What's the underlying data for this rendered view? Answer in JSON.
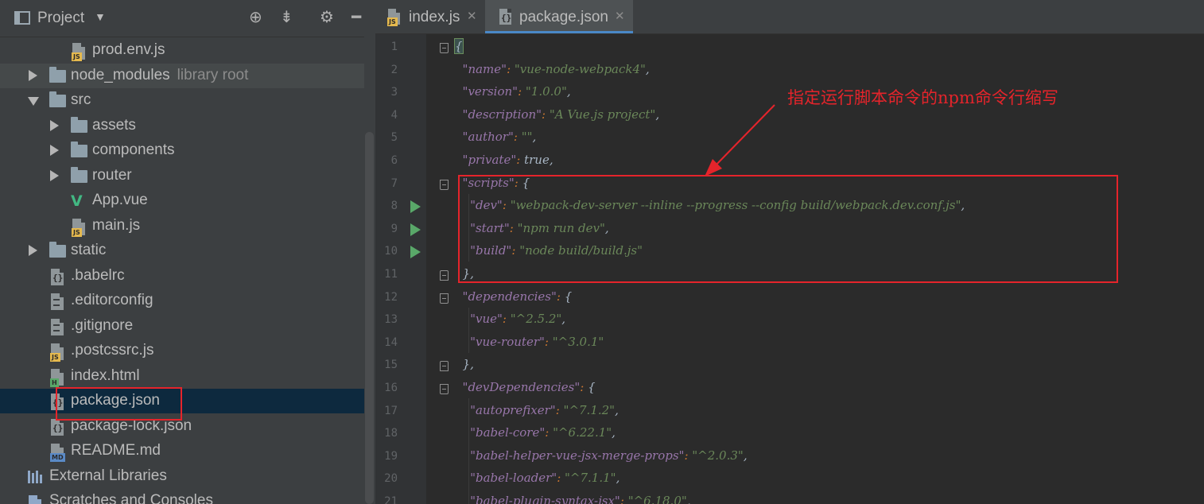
{
  "project": {
    "title": "Project",
    "header_icons": [
      "crosshair-icon",
      "collapse-icon",
      "gear-icon",
      "minimize-icon"
    ],
    "tree": [
      {
        "label": "prod.env.js",
        "icon": "js-file-icon",
        "depth": 3
      },
      {
        "label": "node_modules",
        "extra": "library root",
        "icon": "folder-icon",
        "depth": 1,
        "arrow": "right"
      },
      {
        "label": "src",
        "icon": "folder-icon",
        "depth": 1,
        "arrow": "down"
      },
      {
        "label": "assets",
        "icon": "folder-icon",
        "depth": 2,
        "arrow": "right"
      },
      {
        "label": "components",
        "icon": "folder-icon",
        "depth": 2,
        "arrow": "right"
      },
      {
        "label": "router",
        "icon": "folder-icon",
        "depth": 2,
        "arrow": "right"
      },
      {
        "label": "App.vue",
        "icon": "vue-file-icon",
        "depth": 3
      },
      {
        "label": "main.js",
        "icon": "js-file-icon",
        "depth": 3
      },
      {
        "label": "static",
        "icon": "folder-icon",
        "depth": 1,
        "arrow": "right"
      },
      {
        "label": ".babelrc",
        "icon": "json-file-icon",
        "depth": 2
      },
      {
        "label": ".editorconfig",
        "icon": "text-file-icon",
        "depth": 2
      },
      {
        "label": ".gitignore",
        "icon": "text-file-icon",
        "depth": 2
      },
      {
        "label": ".postcssrc.js",
        "icon": "js-file-icon",
        "depth": 2
      },
      {
        "label": "index.html",
        "icon": "html-file-icon",
        "depth": 2
      },
      {
        "label": "package.json",
        "icon": "json-file-icon",
        "depth": 2,
        "selected": true
      },
      {
        "label": "package-lock.json",
        "icon": "json-file-icon",
        "depth": 2
      },
      {
        "label": "README.md",
        "icon": "md-file-icon",
        "depth": 2
      },
      {
        "label": "External Libraries",
        "icon": "libraries-icon",
        "depth": 1
      },
      {
        "label": "Scratches and Consoles",
        "icon": "scratches-icon",
        "depth": 1
      }
    ]
  },
  "tabs": [
    {
      "label": "index.js",
      "icon": "js-file-icon",
      "active": false
    },
    {
      "label": "package.json",
      "icon": "json-file-icon",
      "active": true
    }
  ],
  "editor": {
    "line_numbers": [
      "1",
      "2",
      "3",
      "4",
      "5",
      "6",
      "7",
      "8",
      "9",
      "10",
      "11",
      "12",
      "13",
      "14",
      "15",
      "16",
      "17",
      "18",
      "19",
      "20",
      "21"
    ],
    "run_lines": [
      8,
      9,
      10
    ],
    "lines": [
      "{",
      "  \"name\": \"vue-node-webpack4\",",
      "  \"version\": \"1.0.0\",",
      "  \"description\": \"A Vue.js project\",",
      "  \"author\": \"\",",
      "  \"private\": true,",
      "  \"scripts\": {",
      "    \"dev\": \"webpack-dev-server --inline --progress --config build/webpack.dev.conf.js\",",
      "    \"start\": \"npm run dev\",",
      "    \"build\": \"node build/build.js\"",
      "  },",
      "  \"dependencies\": {",
      "    \"vue\": \"^2.5.2\",",
      "    \"vue-router\": \"^3.0.1\"",
      "  },",
      "  \"devDependencies\": {",
      "    \"autoprefixer\": \"^7.1.2\",",
      "    \"babel-core\": \"^6.22.1\",",
      "    \"babel-helper-vue-jsx-merge-props\": \"^2.0.3\",",
      "    \"babel-loader\": \"^7.1.1\",",
      "    \"babel-plugin-syntax-jsx\": \"^6.18.0\","
    ]
  },
  "annotation": {
    "text": "指定运行脚本命令的npm命令行缩写",
    "color": "#e5242b"
  },
  "colors": {
    "key": "#9876aa",
    "string": "#6a8759",
    "punct": "#cc7832",
    "selection": "#0d293e",
    "tab_underline": "#4a88c7"
  }
}
